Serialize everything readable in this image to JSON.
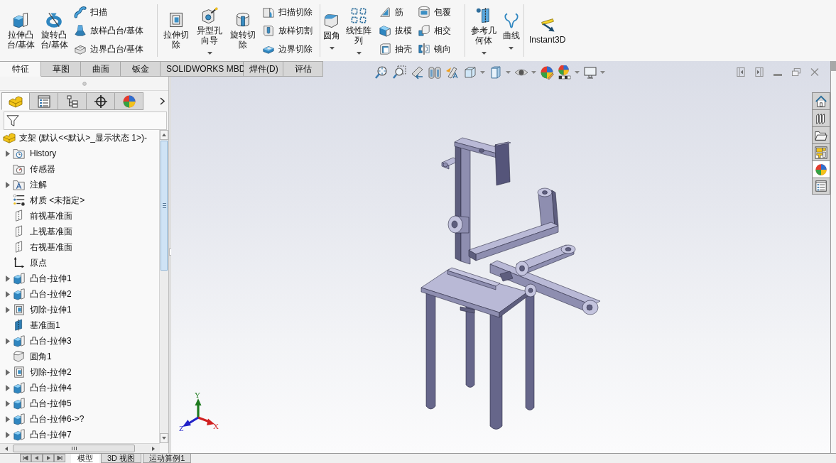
{
  "ribbon": {
    "groups": [
      {
        "items": [
          {
            "kind": "large",
            "label": "拉伸凸台/基体",
            "dropdown": false
          },
          {
            "kind": "large",
            "label": "旋转凸台/基体",
            "dropdown": false
          },
          {
            "kind": "stack",
            "items": [
              {
                "label": "扫描"
              },
              {
                "label": "放样凸台/基体"
              },
              {
                "label": "边界凸台/基体"
              }
            ]
          }
        ]
      },
      {
        "items": [
          {
            "kind": "large",
            "label": "拉伸切除",
            "dropdown": false
          },
          {
            "kind": "large",
            "label": "异型孔向导",
            "dropdown": true
          },
          {
            "kind": "large",
            "label": "旋转切除",
            "dropdown": false
          },
          {
            "kind": "stack",
            "items": [
              {
                "label": "扫描切除"
              },
              {
                "label": "放样切割"
              },
              {
                "label": "边界切除"
              }
            ]
          }
        ]
      },
      {
        "items": [
          {
            "kind": "large",
            "label": "圆角",
            "dropdown": true
          },
          {
            "kind": "large",
            "label": "线性阵列",
            "dropdown": true
          },
          {
            "kind": "stack",
            "items": [
              {
                "label": "筋"
              },
              {
                "label": "拔模"
              },
              {
                "label": "抽壳"
              }
            ]
          },
          {
            "kind": "stack",
            "items": [
              {
                "label": "包覆"
              },
              {
                "label": "相交"
              },
              {
                "label": "镜向"
              }
            ]
          }
        ]
      },
      {
        "items": [
          {
            "kind": "large",
            "label": "参考几何体",
            "dropdown": true
          },
          {
            "kind": "large",
            "label": "曲线",
            "dropdown": true
          }
        ]
      },
      {
        "items": [
          {
            "kind": "large",
            "label": "Instant3D",
            "dropdown": false
          }
        ]
      }
    ]
  },
  "command_tabs": [
    {
      "label": "特征",
      "selected": true
    },
    {
      "label": "草图",
      "selected": false
    },
    {
      "label": "曲面",
      "selected": false
    },
    {
      "label": "钣金",
      "selected": false
    },
    {
      "label": "SOLIDWORKS MBD",
      "selected": false
    },
    {
      "label": "焊件(D)",
      "selected": false
    },
    {
      "label": "评估",
      "selected": false
    }
  ],
  "feature_panel": {
    "tabs": [
      {
        "selected": true
      },
      {
        "selected": false
      },
      {
        "selected": false
      },
      {
        "selected": false
      },
      {
        "selected": false
      }
    ],
    "tree": {
      "root": "支架 (默认<<默认>_显示状态 1>)-",
      "items": [
        {
          "label": "History",
          "kind": "history",
          "expandable": true
        },
        {
          "label": "传感器",
          "kind": "sensors",
          "expandable": false
        },
        {
          "label": "注解",
          "kind": "annotations",
          "expandable": true
        },
        {
          "label": "材质 <未指定>",
          "kind": "material",
          "expandable": false
        },
        {
          "label": "前视基准面",
          "kind": "plane",
          "expandable": false
        },
        {
          "label": "上视基准面",
          "kind": "plane",
          "expandable": false
        },
        {
          "label": "右视基准面",
          "kind": "plane",
          "expandable": false
        },
        {
          "label": "原点",
          "kind": "origin",
          "expandable": false
        },
        {
          "label": "凸台-拉伸1",
          "kind": "boss",
          "expandable": true
        },
        {
          "label": "凸台-拉伸2",
          "kind": "boss",
          "expandable": true
        },
        {
          "label": "切除-拉伸1",
          "kind": "cut",
          "expandable": true
        },
        {
          "label": "基准面1",
          "kind": "datum",
          "expandable": false
        },
        {
          "label": "凸台-拉伸3",
          "kind": "boss",
          "expandable": true
        },
        {
          "label": "圆角1",
          "kind": "fillet",
          "expandable": false
        },
        {
          "label": "切除-拉伸2",
          "kind": "cut",
          "expandable": true
        },
        {
          "label": "凸台-拉伸4",
          "kind": "boss",
          "expandable": true
        },
        {
          "label": "凸台-拉伸5",
          "kind": "boss",
          "expandable": true
        },
        {
          "label": "凸台-拉伸6->?",
          "kind": "boss",
          "expandable": true
        },
        {
          "label": "凸台-拉伸7",
          "kind": "boss",
          "expandable": true
        }
      ]
    }
  },
  "view_toolbar": [
    {
      "dropdown": false
    },
    {
      "dropdown": false
    },
    {
      "dropdown": false
    },
    {
      "dropdown": false
    },
    {
      "dropdown": false
    },
    {
      "dropdown": true
    },
    {
      "dropdown": true
    },
    {
      "dropdown": true
    },
    {
      "dropdown": false
    },
    {
      "dropdown": true
    },
    {
      "dropdown": true
    }
  ],
  "task_pane_tabs": [
    {
      "selected": false
    },
    {
      "selected": false
    },
    {
      "selected": false
    },
    {
      "selected": false
    },
    {
      "selected": true
    },
    {
      "selected": false
    }
  ],
  "triad": [
    {
      "label": "Y",
      "color": "#1e7a1e"
    },
    {
      "label": "X",
      "color": "#d02020"
    },
    {
      "label": "Z",
      "color": "#2222c8"
    }
  ],
  "bottom_tabs": [
    {
      "label": "模型",
      "selected": true
    },
    {
      "label": "3D 视图",
      "selected": false
    },
    {
      "label": "运动算例1",
      "selected": false
    }
  ]
}
